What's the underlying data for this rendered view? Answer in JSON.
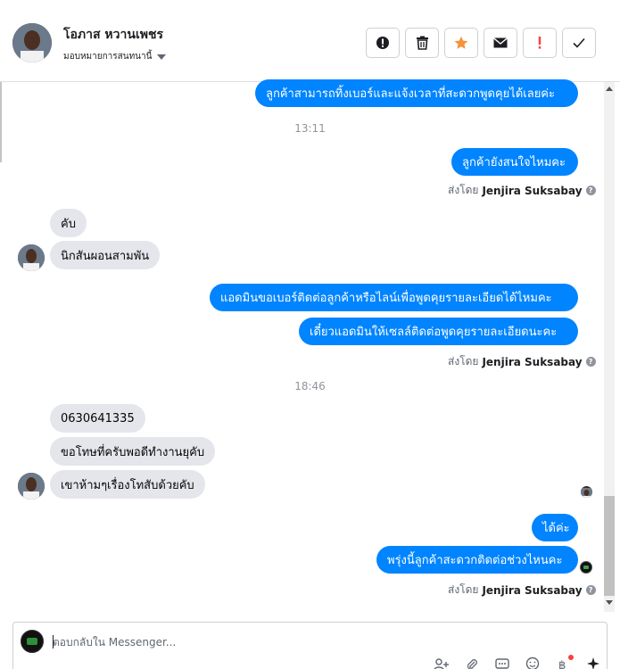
{
  "header": {
    "contact_name": "โอภาส หวานเพชร",
    "assign_label": "มอบหมายการสนทนานี้",
    "actions": [
      {
        "name": "spam-button",
        "icon": "alert-circle-icon",
        "color": "#1c1e21"
      },
      {
        "name": "delete-button",
        "icon": "trash-icon",
        "color": "#1c1e21"
      },
      {
        "name": "star-button",
        "icon": "star-icon",
        "color": "#f7923a"
      },
      {
        "name": "mark-unread-button",
        "icon": "envelope-icon",
        "color": "#1c1e21"
      },
      {
        "name": "follow-up-button",
        "icon": "exclamation-icon",
        "color": "#fa3e3e"
      },
      {
        "name": "done-button",
        "icon": "check-icon",
        "color": "#1c1e21"
      }
    ]
  },
  "messages": {
    "out_1": "ลูกค้าสามารถทิ้งเบอร์และแจ้งเวลาที่สะดวกพูดคุยได้เลยค่ะ",
    "time_1": "13:11",
    "out_2": "ลูกค้ายังสนใจไหมคะ",
    "sent_by_1": {
      "prefix": "ส่งโดย",
      "name": "Jenjira Suksabay"
    },
    "in_1": "คับ",
    "in_2": "นิกสันผอนสามพัน",
    "out_3": "แอดมินขอเบอร์ติดต่อลูกค้าหรือไลน์เพื่อพูดคุยรายละเอียดได้ไหมคะ",
    "out_4": "เดี๋ยวแอดมินให้เซลล์ติดต่อพูดคุยรายละเอียดนะคะ",
    "sent_by_2": {
      "prefix": "ส่งโดย",
      "name": "Jenjira Suksabay"
    },
    "time_2": "18:46",
    "in_3": "0630641335",
    "in_4": "ขอโทษที่ครับพอดีทำงานยุคับ",
    "in_5": "เขาห้ามๆเรื่องโทสับด้วยคับ",
    "out_5": "ได้ค่ะ",
    "out_6": "พรุ่งนี้ลูกค้าสะดวกติดต่อช่วงไหนคะ",
    "sent_by_3": {
      "prefix": "ส่งโดย",
      "name": "Jenjira Suksabay"
    }
  },
  "composer": {
    "placeholder": "ตอบกลับใน Messenger...",
    "tools": [
      "add-person-icon",
      "attachment-icon",
      "saved-replies-icon",
      "emoji-icon",
      "payment-icon",
      "sparkle-icon"
    ]
  },
  "colors": {
    "outgoing_bubble": "#0084ff",
    "incoming_bubble": "#e4e6eb",
    "star": "#f7923a",
    "follow_up": "#fa3e3e"
  }
}
